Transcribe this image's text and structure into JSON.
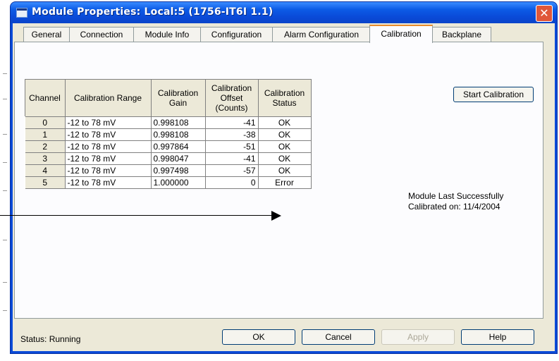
{
  "window": {
    "title": "Module Properties: Local:5 (1756-IT6I 1.1)"
  },
  "tabs": [
    {
      "label": "General"
    },
    {
      "label": "Connection"
    },
    {
      "label": "Module Info"
    },
    {
      "label": "Configuration"
    },
    {
      "label": "Alarm Configuration"
    },
    {
      "label": "Calibration"
    },
    {
      "label": "Backplane"
    }
  ],
  "active_tab": "Calibration",
  "table": {
    "headers": {
      "channel": "Channel",
      "range": "Calibration Range",
      "gain_1": "Calibration",
      "gain_2": "Gain",
      "offset_1": "Calibration",
      "offset_2": "Offset",
      "offset_3": "(Counts)",
      "status_1": "Calibration",
      "status_2": "Status"
    },
    "rows": [
      {
        "channel": "0",
        "range": "-12 to 78 mV",
        "gain": "0.998108",
        "offset": "-41",
        "status": "OK"
      },
      {
        "channel": "1",
        "range": "-12 to 78 mV",
        "gain": "0.998108",
        "offset": "-38",
        "status": "OK"
      },
      {
        "channel": "2",
        "range": "-12 to 78 mV",
        "gain": "0.997864",
        "offset": "-51",
        "status": "OK"
      },
      {
        "channel": "3",
        "range": "-12 to 78 mV",
        "gain": "0.998047",
        "offset": "-41",
        "status": "OK"
      },
      {
        "channel": "4",
        "range": "-12 to 78 mV",
        "gain": "0.997498",
        "offset": "-57",
        "status": "OK"
      },
      {
        "channel": "5",
        "range": "-12 to 78 mV",
        "gain": "1.000000",
        "offset": "0",
        "status": "Error"
      }
    ]
  },
  "buttons": {
    "start_calibration": "Start Calibration",
    "ok": "OK",
    "cancel": "Cancel",
    "apply": "Apply",
    "help": "Help"
  },
  "last_calibration": {
    "line1": "Module Last Successfully",
    "line2": "Calibrated on:  11/4/2004"
  },
  "status_text": "Status:  Running"
}
